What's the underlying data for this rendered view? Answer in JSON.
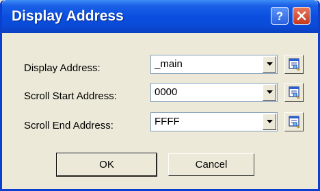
{
  "window": {
    "title": "Display Address"
  },
  "fields": [
    {
      "label": "Display Address:",
      "value": "_main"
    },
    {
      "label": "Scroll Start Address:",
      "value": "0000"
    },
    {
      "label": "Scroll End Address:",
      "value": "FFFF"
    }
  ],
  "buttons": {
    "ok": "OK",
    "cancel": "Cancel"
  },
  "icons": {
    "help": "help-icon",
    "close": "close-icon",
    "picker": "symbol-picker-icon",
    "dropdown": "chevron-down-icon"
  },
  "colors": {
    "titlebar": "#0b4fe0",
    "background": "#ece9d8",
    "close": "#c5381e"
  }
}
